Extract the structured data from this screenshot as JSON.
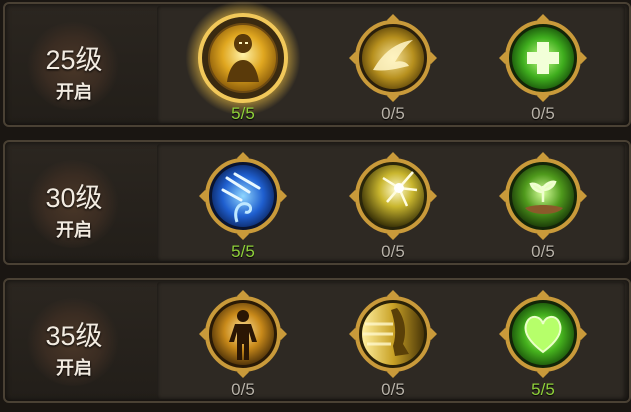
{
  "rows": [
    {
      "level": "25级",
      "unlock": "开启",
      "skills": [
        {
          "icon": "golden-aura-figure-icon",
          "progress": "5/5",
          "maxed": true,
          "selected": true
        },
        {
          "icon": "golden-eagle-wing-icon",
          "progress": "0/5",
          "maxed": false,
          "selected": false
        },
        {
          "icon": "green-heal-cross-icon",
          "progress": "0/5",
          "maxed": false,
          "selected": false
        }
      ]
    },
    {
      "level": "30级",
      "unlock": "开启",
      "skills": [
        {
          "icon": "blue-meteor-staff-icon",
          "progress": "5/5",
          "maxed": true,
          "selected": false
        },
        {
          "icon": "golden-light-burst-icon",
          "progress": "0/5",
          "maxed": false,
          "selected": false
        },
        {
          "icon": "green-sprout-hand-icon",
          "progress": "0/5",
          "maxed": false,
          "selected": false
        }
      ]
    },
    {
      "level": "35级",
      "unlock": "开启",
      "skills": [
        {
          "icon": "glowing-body-figure-icon",
          "progress": "0/5",
          "maxed": false,
          "selected": false
        },
        {
          "icon": "swift-leg-dash-icon",
          "progress": "0/5",
          "maxed": false,
          "selected": false
        },
        {
          "icon": "green-heart-icon",
          "progress": "5/5",
          "maxed": true,
          "selected": false
        }
      ]
    }
  ],
  "colors": {
    "maxed_text": "#8fd13a",
    "normal_text": "#b8b2a8",
    "frame_gold": "#c99a3a"
  }
}
